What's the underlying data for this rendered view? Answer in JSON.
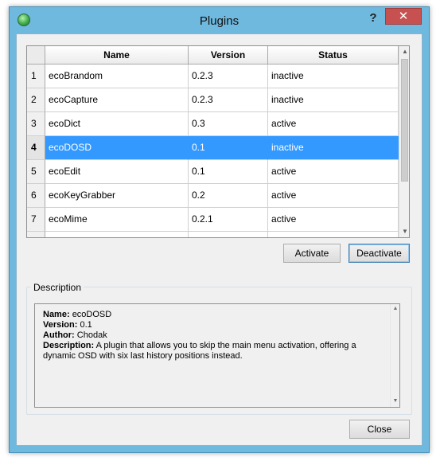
{
  "window": {
    "title": "Plugins",
    "help_glyph": "?",
    "close_glyph": "✕"
  },
  "table": {
    "columns": [
      "Name",
      "Version",
      "Status"
    ],
    "rows": [
      {
        "num": "1",
        "name": "ecoBrandom",
        "version": "0.2.3",
        "status": "inactive"
      },
      {
        "num": "2",
        "name": "ecoCapture",
        "version": "0.2.3",
        "status": "inactive"
      },
      {
        "num": "3",
        "name": "ecoDict",
        "version": "0.3",
        "status": "active"
      },
      {
        "num": "4",
        "name": "ecoDOSD",
        "version": "0.1",
        "status": "inactive",
        "selected": true
      },
      {
        "num": "5",
        "name": "ecoEdit",
        "version": "0.1",
        "status": "active"
      },
      {
        "num": "6",
        "name": "ecoKeyGrabber",
        "version": "0.2",
        "status": "active"
      },
      {
        "num": "7",
        "name": "ecoMime",
        "version": "0.2.1",
        "status": "active"
      }
    ]
  },
  "buttons": {
    "activate": "Activate",
    "deactivate": "Deactivate",
    "close": "Close"
  },
  "description": {
    "group_label": "Description",
    "name_label": "Name:",
    "name_value": "ecoDOSD",
    "version_label": "Version:",
    "version_value": "0.1",
    "author_label": "Author:",
    "author_value": "Chodak",
    "description_label": "Description:",
    "description_value": "A plugin that allows you to skip the main menu activation, offering a dynamic OSD with six last history positions instead."
  }
}
